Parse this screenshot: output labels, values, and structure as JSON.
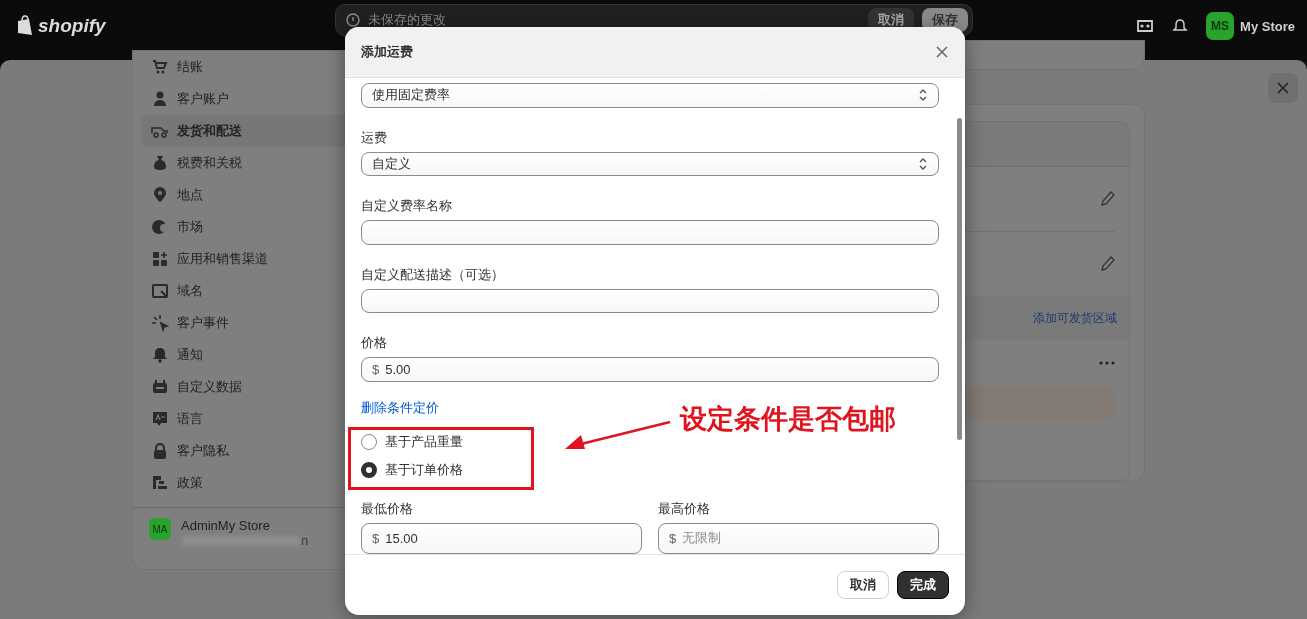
{
  "topbar": {
    "logo": "shopify",
    "save_bar": {
      "message": "未保存的更改",
      "buttons": [
        "取消",
        "保存"
      ]
    },
    "store": {
      "avatar": "MS",
      "name": "My Store"
    }
  },
  "sidebar": {
    "items": [
      {
        "label": "结账",
        "selected": false
      },
      {
        "label": "客户账户",
        "selected": false
      },
      {
        "label": "发货和配送",
        "selected": true
      },
      {
        "label": "税费和关税",
        "selected": false
      },
      {
        "label": "地点",
        "selected": false
      },
      {
        "label": "市场",
        "selected": false
      },
      {
        "label": "应用和销售渠道",
        "selected": false
      },
      {
        "label": "域名",
        "selected": false
      },
      {
        "label": "客户事件",
        "selected": false
      },
      {
        "label": "通知",
        "selected": false
      },
      {
        "label": "自定义数据",
        "selected": false
      },
      {
        "label": "语言",
        "selected": false
      },
      {
        "label": "客户隐私",
        "selected": false
      },
      {
        "label": "政策",
        "selected": false
      }
    ],
    "user": {
      "avatar": "MA",
      "name": "AdminMy Store",
      "email_tail": "n"
    }
  },
  "zones_card": {
    "link": "添加可发货区域"
  },
  "modal": {
    "title": "添加运费",
    "fields": [
      {
        "kind": "select",
        "value": "使用固定费率"
      },
      {
        "kind": "select",
        "label": "运费",
        "value": "自定义"
      },
      {
        "kind": "text",
        "label": "自定义费率名称"
      },
      {
        "kind": "text",
        "label": "自定义配送描述（可选）"
      },
      {
        "kind": "money",
        "label": "价格",
        "prefix": "$",
        "value": "5.00"
      }
    ],
    "link": "删除条件定价",
    "conditions": [
      {
        "label": "基于产品重量",
        "selected": false
      },
      {
        "label": "基于订单价格",
        "selected": true
      }
    ],
    "range": [
      {
        "label": "最低价格",
        "prefix": "$",
        "value": "15.00"
      },
      {
        "label": "最高价格",
        "prefix": "$",
        "placeholder": "无限制"
      }
    ],
    "buttons": [
      {
        "label": "取消",
        "kind": "secondary"
      },
      {
        "label": "完成",
        "kind": "primary"
      }
    ]
  },
  "annotation": {
    "text": "设定条件是否包邮"
  }
}
